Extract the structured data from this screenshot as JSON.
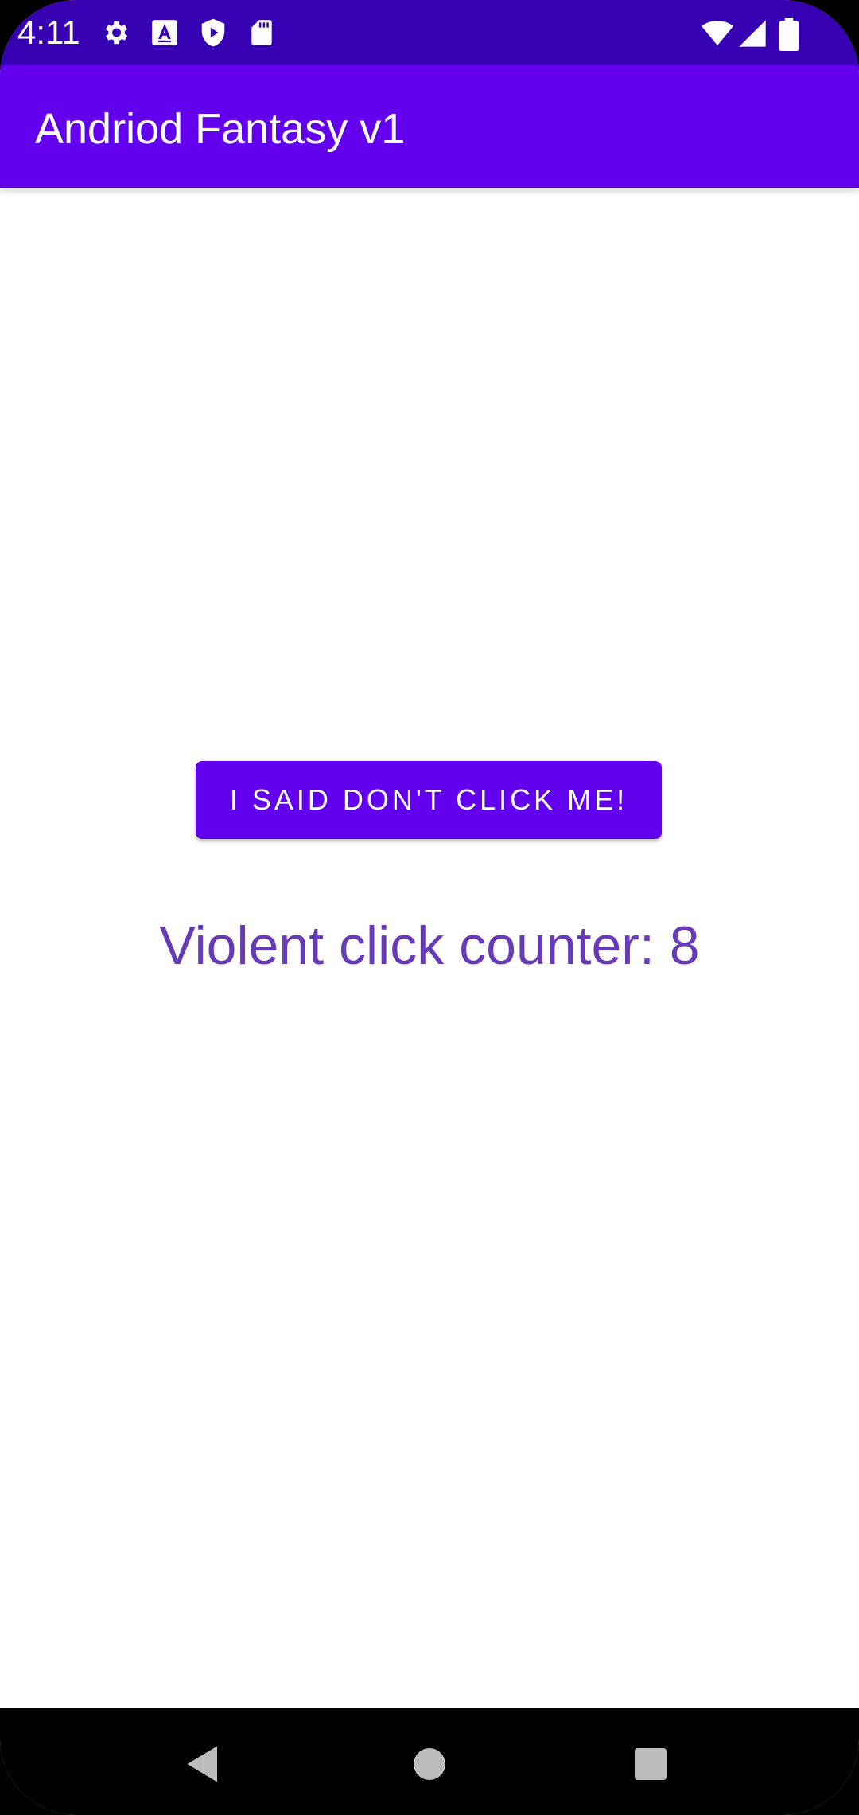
{
  "status_bar": {
    "time": "4:11",
    "icons_left": [
      "settings-icon",
      "keyboard-a-icon",
      "play-protect-icon",
      "sd-card-icon"
    ],
    "icons_right": [
      "wifi-icon",
      "cell-signal-icon",
      "battery-icon"
    ],
    "background_color": "#3700b3"
  },
  "app_bar": {
    "title": "Andriod Fantasy v1",
    "background_color": "#6200ee"
  },
  "main": {
    "button_label": "I SAID DON'T CLICK ME!",
    "counter_text": "Violent click counter: 8",
    "counter_color": "#673ab7"
  },
  "nav_bar": {
    "buttons": [
      "back-icon",
      "home-icon",
      "recents-icon"
    ]
  }
}
